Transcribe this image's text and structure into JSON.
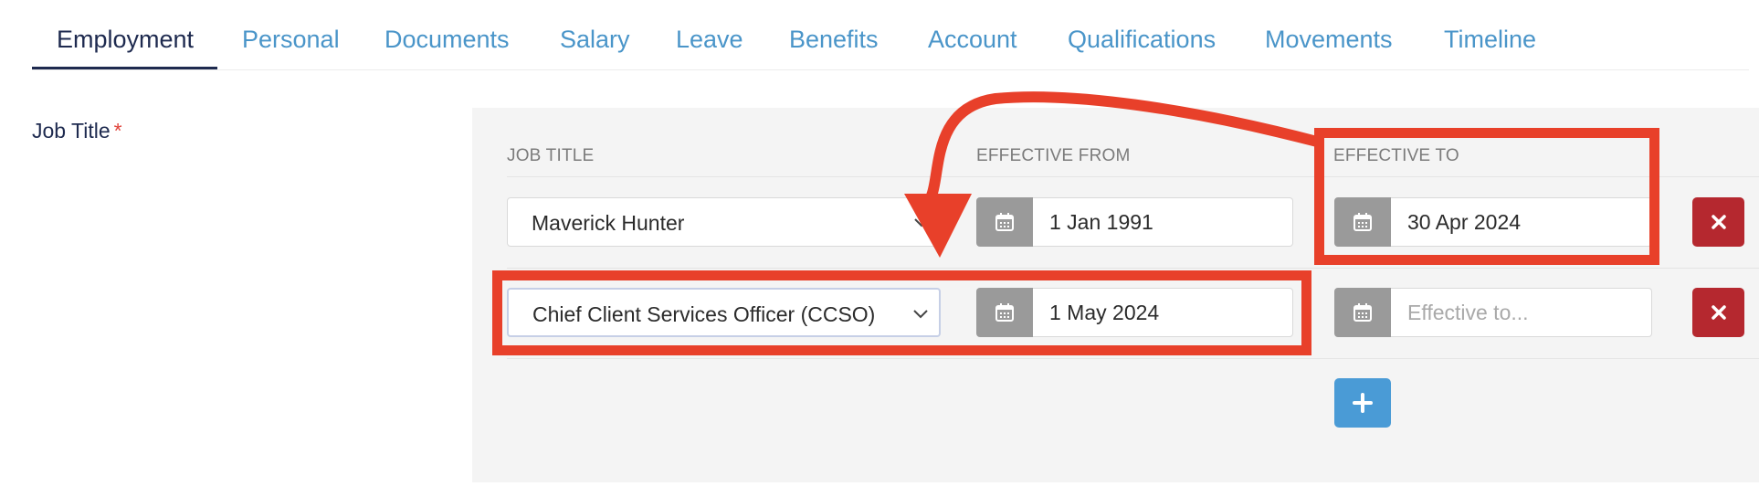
{
  "tabs": [
    {
      "label": "Employment",
      "active": true
    },
    {
      "label": "Personal"
    },
    {
      "label": "Documents"
    },
    {
      "label": "Salary"
    },
    {
      "label": "Leave"
    },
    {
      "label": "Benefits"
    },
    {
      "label": "Account"
    },
    {
      "label": "Qualifications"
    },
    {
      "label": "Movements"
    },
    {
      "label": "Timeline"
    }
  ],
  "field": {
    "label": "Job Title",
    "required_mark": "*"
  },
  "columns": {
    "job_title": "JOB TITLE",
    "effective_from": "EFFECTIVE FROM",
    "effective_to": "EFFECTIVE TO"
  },
  "rows": [
    {
      "job_title": "Maverick Hunter",
      "effective_from": "1 Jan 1991",
      "effective_to": "30 Apr 2024"
    },
    {
      "job_title": "Chief Client Services Officer (CCSO)",
      "effective_from": "1 May 2024",
      "effective_to": "",
      "effective_to_placeholder": "Effective to..."
    }
  ],
  "icons": {
    "calendar": "calendar-icon",
    "delete": "x-icon",
    "add": "plus-icon",
    "dropdown": "chevron-down-icon"
  },
  "colors": {
    "active_tab": "#1e2a4f",
    "tab": "#4a95c9",
    "delete": "#b5282f",
    "add": "#4a9bd6",
    "annotation": "#e8402a"
  }
}
